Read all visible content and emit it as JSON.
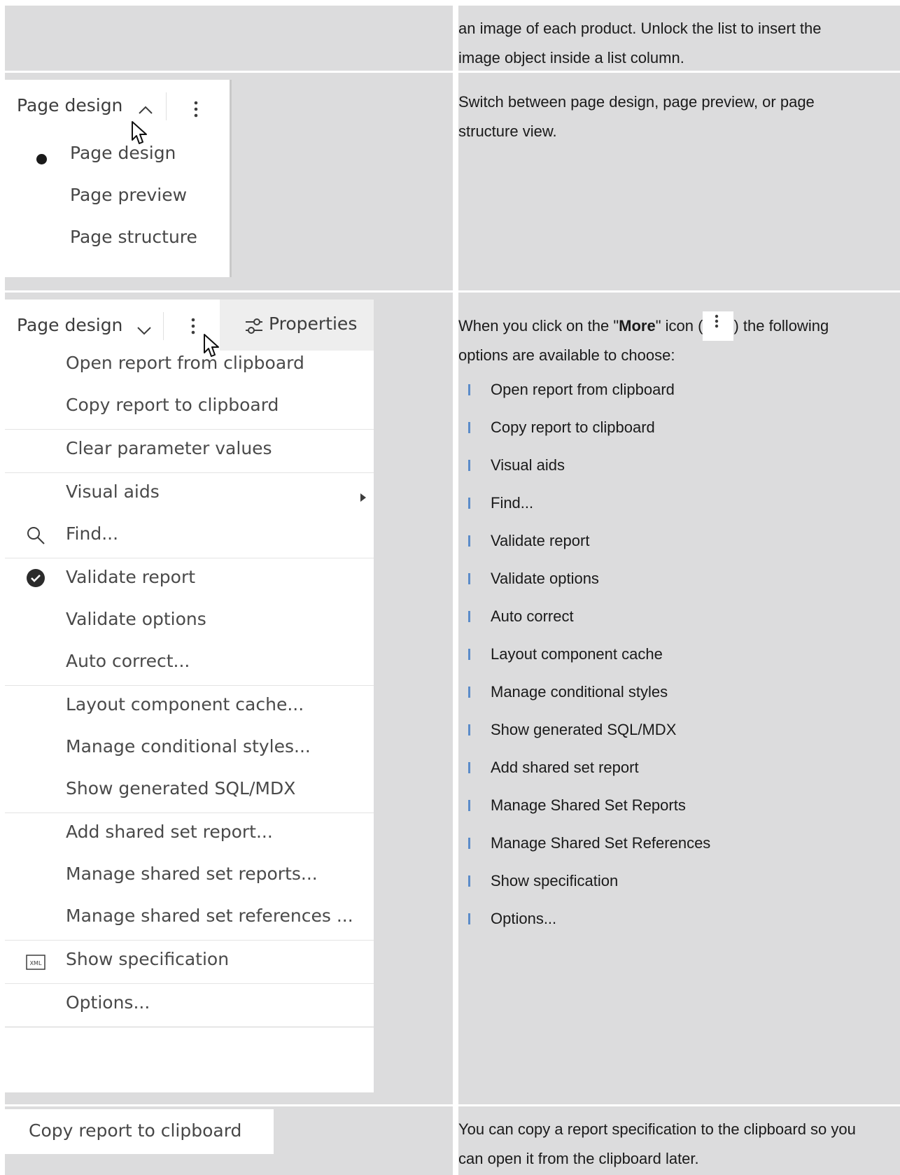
{
  "row1": {
    "lines": [
      "an image of each product. Unlock the list to insert the",
      "image object inside a list column."
    ]
  },
  "row2": {
    "selector_label": "Page design",
    "chevron": "chevron-up-icon",
    "more_icon": "overflow-menu-vertical-icon",
    "items": [
      "Page design",
      "Page preview",
      "Page structure"
    ],
    "selected_item": "Page design",
    "description_lines": [
      "Switch between page design, page preview, or page",
      "structure view."
    ]
  },
  "row3": {
    "selector_label": "Page design",
    "chevron": "chevron-down-icon",
    "more_icon": "overflow-menu-vertical-icon",
    "properties_label": "Properties",
    "properties_icon": "settings-adjust-icon",
    "menu_items": [
      {
        "label": "Open report from clipboard",
        "icon": ""
      },
      {
        "label": "Copy report to clipboard",
        "icon": ""
      },
      {
        "label": "Clear parameter values",
        "icon": ""
      },
      {
        "label": "Visual aids",
        "icon": "caret-right-icon"
      },
      {
        "label": "Find...",
        "icon": "search-icon"
      },
      {
        "label": "Validate report",
        "icon": "checkmark-filled-icon"
      },
      {
        "label": "Validate options",
        "icon": ""
      },
      {
        "label": "Auto correct...",
        "icon": ""
      },
      {
        "label": "Layout component cache...",
        "icon": ""
      },
      {
        "label": "Manage conditional styles...",
        "icon": ""
      },
      {
        "label": "Show generated SQL/MDX",
        "icon": ""
      },
      {
        "label": "Add shared set report...",
        "icon": ""
      },
      {
        "label": "Manage shared set reports...",
        "icon": ""
      },
      {
        "label": "Manage shared set references ...",
        "icon": ""
      },
      {
        "label": "Show specification",
        "icon": "xml-icon"
      },
      {
        "label": "Options...",
        "icon": ""
      }
    ],
    "intro_part1": "When you click on the \"",
    "intro_bold": "More",
    "intro_part2": "\" icon (",
    "intro_part3": ") the following",
    "intro_line2": "options are available to choose:",
    "bullets": [
      "Open report from clipboard",
      "Copy report to clipboard",
      "Visual aids",
      "Find...",
      "Validate report",
      "Validate options",
      "Auto correct",
      "Layout component cache",
      "Manage conditional styles",
      "Show generated SQL/MDX",
      "Add shared set report",
      "Manage Shared Set Reports",
      "Manage Shared Set References",
      "Show specification",
      "Options..."
    ]
  },
  "row4": {
    "button_label": "Copy report to clipboard",
    "description_lines": [
      "You can copy a report specification to the clipboard so you",
      "can open it from the clipboard later."
    ]
  }
}
